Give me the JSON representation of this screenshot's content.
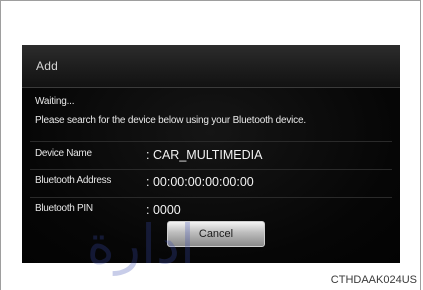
{
  "dialog": {
    "title": "Add",
    "status": "Waiting...",
    "instruction": "Please search for the device below using your Bluetooth device.",
    "rows": [
      {
        "label": "Device Name",
        "value": ": CAR_MULTIMEDIA"
      },
      {
        "label": "Bluetooth Address",
        "value": ": 00:00:00:00:00:00"
      },
      {
        "label": "Bluetooth PIN",
        "value": ": 0000"
      }
    ],
    "cancel_label": "Cancel"
  },
  "figure_code": "CTHDAAK024US",
  "colors": {
    "screen_background": "#050505",
    "title_bar": "#1d1d1d",
    "button_top": "#f4f4f4",
    "button_bottom": "#8a8a8a",
    "watermark": "#3a4bb0"
  },
  "watermark_text": "ادارة"
}
